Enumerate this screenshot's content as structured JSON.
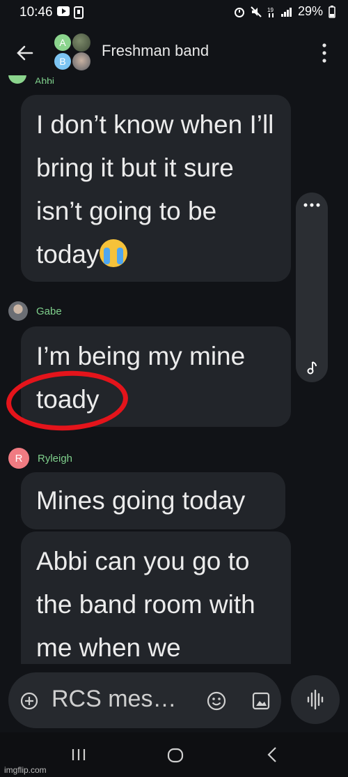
{
  "status": {
    "time": "10:46",
    "battery": "29%"
  },
  "header": {
    "avatar_a_letter": "A",
    "avatar_b_letter": "B",
    "title": "Freshman band"
  },
  "messages": [
    {
      "sender": "Abbi",
      "text": "I don’t know when I’ll bring it but it sure isn’t going to be today"
    },
    {
      "sender": "Gabe",
      "avatar_letter": "",
      "text_line1": "I’m being my mine",
      "text_line2": "toady"
    },
    {
      "sender": "Ryleigh",
      "avatar_letter": "R",
      "text": "Mines going today"
    },
    {
      "sender": "Ryleigh",
      "text": "Abbi can you go to the band room with me when we"
    }
  ],
  "composer": {
    "placeholder": "RCS mes…"
  },
  "watermark": "imgflip.com",
  "colors": {
    "background": "#111317",
    "bubble": "#22252a",
    "sender_name": "#7fd08c",
    "highlight_circle": "#e4141b"
  },
  "icons": {
    "back": "arrow-left-icon",
    "menu": "more-vertical-icon",
    "emoji": "smiley-icon",
    "gallery": "image-icon",
    "voice": "waveform-icon"
  }
}
